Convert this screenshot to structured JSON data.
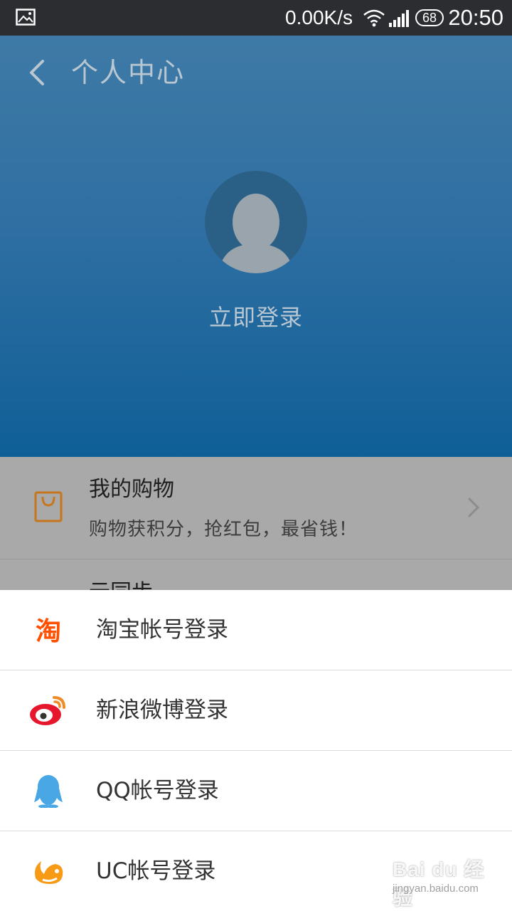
{
  "status_bar": {
    "network_speed": "0.00K/s",
    "battery_level": "68",
    "time": "20:50"
  },
  "header": {
    "title": "个人中心"
  },
  "profile": {
    "login_label": "立即登录"
  },
  "list": {
    "shopping_title": "我的购物",
    "shopping_subtitle": "购物获积分，抢红包，最省钱！",
    "cloud_sync_title": "云同步"
  },
  "login_sheet": {
    "items": [
      {
        "label": "淘宝帐号登录",
        "icon": "taobao-icon",
        "color": "#ff5000"
      },
      {
        "label": "新浪微博登录",
        "icon": "weibo-icon",
        "color": "#e6162d"
      },
      {
        "label": "QQ帐号登录",
        "icon": "qq-icon",
        "color": "#49a7e6"
      },
      {
        "label": "UC帐号登录",
        "icon": "uc-icon",
        "color": "#f79a16"
      }
    ]
  },
  "watermark": {
    "text": "Bai du 经验",
    "url": "jingyan.baidu.com"
  }
}
